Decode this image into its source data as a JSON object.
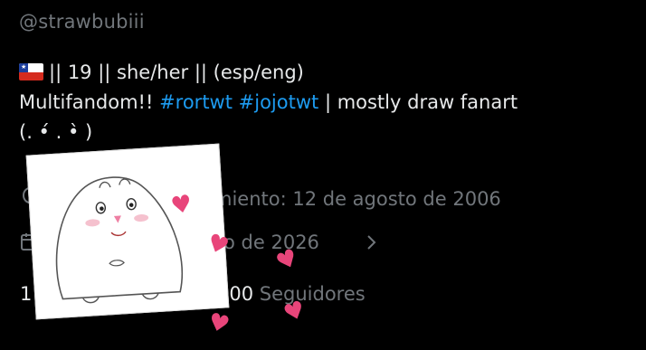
{
  "profile": {
    "handle": "@strawbubiii",
    "bio_line1_text": "|| 19 || she/her || (esp/eng)",
    "bio_line2_prefix": "Multifandom!! ",
    "hashtag1": "#rortwt",
    "hashtag2": "#jojotwt",
    "bio_line2_suffix": " | mostly draw fanart",
    "bio_line3": "(. •́ . •̀ )",
    "birthday": "miento: 12 de agosto de 2006",
    "joined": "zo de 2026",
    "following_count": "1",
    "followers_count": "100",
    "followers_label": "Seguidores"
  },
  "icons": {
    "flag": "chile-flag-icon",
    "balloon": "balloon-icon",
    "calendar": "calendar-icon",
    "chevron": "chevron-right-icon",
    "heart": "heart-icon"
  },
  "colors": {
    "background": "#000000",
    "text": "#e7e9ea",
    "muted": "#71767b",
    "hashtag": "#1d9bf0",
    "heart": "#e8457a"
  }
}
